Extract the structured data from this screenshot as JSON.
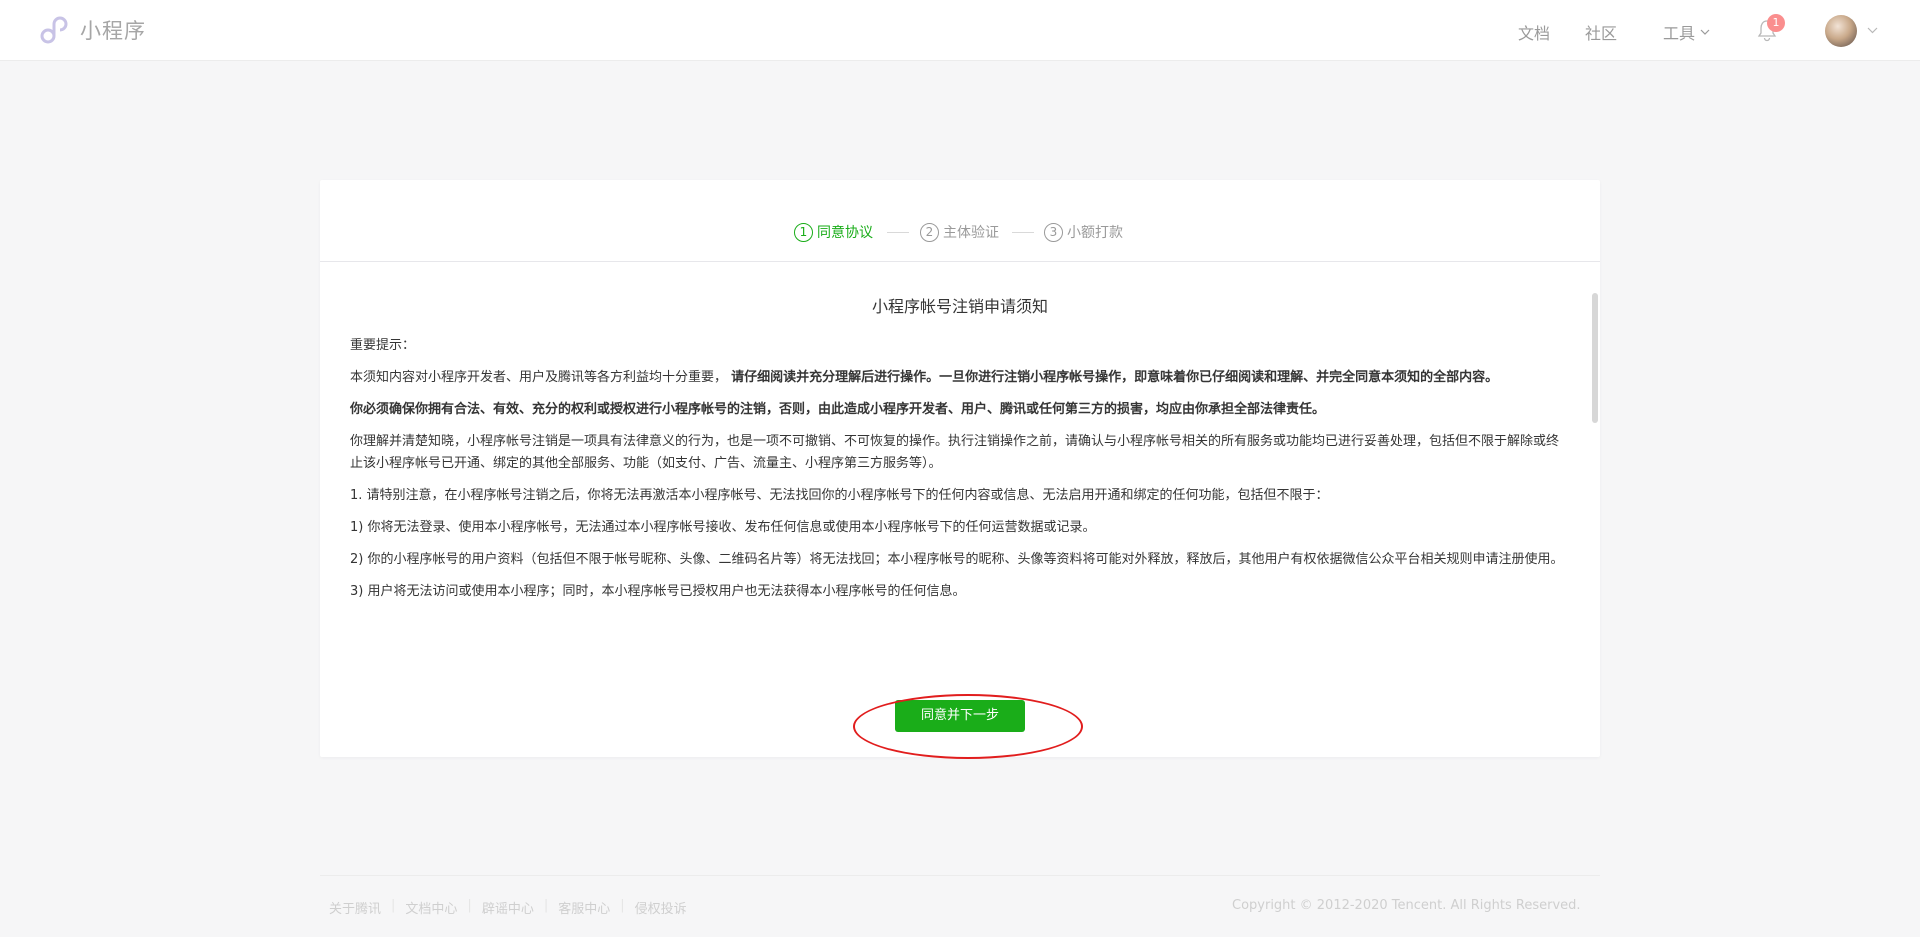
{
  "header": {
    "logo_text": "小程序",
    "nav": {
      "docs": "文档",
      "community": "社区",
      "tools": "工具"
    },
    "notification_count": "1"
  },
  "steps": [
    {
      "num": "1",
      "label": "同意协议"
    },
    {
      "num": "2",
      "label": "主体验证"
    },
    {
      "num": "3",
      "label": "小额打款"
    }
  ],
  "notice": {
    "title": "小程序帐号注销申请须知",
    "p1": "重要提示：",
    "p2_normal": "本须知内容对小程序开发者、用户及腾讯等各方利益均十分重要，",
    "p2_bold": "请仔细阅读并充分理解后进行操作。一旦你进行注销小程序帐号操作，即意味着你已仔细阅读和理解、并完全同意本须知的全部内容。",
    "p3_bold": "你必须确保你拥有合法、有效、充分的权利或授权进行小程序帐号的注销，否则，由此造成小程序开发者、用户、腾讯或任何第三方的损害，均应由你承担全部法律责任。",
    "p4": "你理解并清楚知晓，小程序帐号注销是一项具有法律意义的行为，也是一项不可撤销、不可恢复的操作。执行注销操作之前，请确认与小程序帐号相关的所有服务或功能均已进行妥善处理，包括但不限于解除或终止该小程序帐号已开通、绑定的其他全部服务、功能（如支付、广告、流量主、小程序第三方服务等）。",
    "p5": "1. 请特别注意，在小程序帐号注销之后，你将无法再激活本小程序帐号、无法找回你的小程序帐号下的任何内容或信息、无法启用开通和绑定的任何功能，包括但不限于：",
    "p6": "1) 你将无法登录、使用本小程序帐号，无法通过本小程序帐号接收、发布任何信息或使用本小程序帐号下的任何运营数据或记录。",
    "p7": "2) 你的小程序帐号的用户资料（包括但不限于帐号昵称、头像、二维码名片等）将无法找回；本小程序帐号的昵称、头像等资料将可能对外释放，释放后，其他用户有权依据微信公众平台相关规则申请注册使用。",
    "p8": "3) 用户将无法访问或使用本小程序；同时，本小程序帐号已授权用户也无法获得本小程序帐号的任何信息。"
  },
  "next_button": "同意并下一步",
  "footer": {
    "links": [
      "关于腾讯",
      "文档中心",
      "辟谣中心",
      "客服中心",
      "侵权投诉"
    ],
    "copyright": "Copyright © 2012-2020 Tencent. All Rights Reserved."
  }
}
